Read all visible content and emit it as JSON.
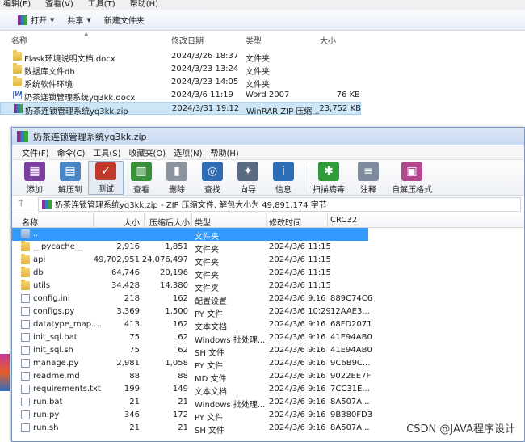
{
  "explorer": {
    "menu": [
      "编辑(E)",
      "查看(V)",
      "工具(T)",
      "帮助(H)"
    ],
    "toolbar": {
      "open": "打开",
      "share": "共享",
      "new_folder": "新建文件夹"
    },
    "columns": {
      "name": "名称",
      "date": "修改日期",
      "type": "类型",
      "size": "大小"
    },
    "rows": [
      {
        "name": "Flask环境说明文档.docx",
        "date": "2024/3/26 18:37",
        "type": "文件夹",
        "size": "",
        "icon": "folder-icon"
      },
      {
        "name": "数据库文件db",
        "date": "2024/3/23 13:24",
        "type": "文件夹",
        "size": "",
        "icon": "folder-icon"
      },
      {
        "name": "系统软件环境",
        "date": "2024/3/23 14:05",
        "type": "文件夹",
        "size": "",
        "icon": "folder-icon"
      },
      {
        "name": "奶茶连锁管理系统yq3kk.docx",
        "date": "2024/3/6 11:19",
        "type": "Word 2007",
        "size": "76 KB",
        "icon": "word-doc-icon"
      },
      {
        "name": "奶茶连锁管理系统yq3kk.zip",
        "date": "2024/3/31 19:12",
        "type": "WinRAR ZIP 压缩...",
        "size": "23,752 KB",
        "icon": "winrar-archive-icon"
      }
    ]
  },
  "winrar": {
    "title": "奶茶连锁管理系统yq3kk.zip",
    "menu": [
      "文件(F)",
      "命令(C)",
      "工具(S)",
      "收藏夹(O)",
      "选项(N)",
      "帮助(H)"
    ],
    "tools": [
      {
        "label": "添加",
        "icon": "add-icon",
        "color": "#7b3f9e"
      },
      {
        "label": "解压到",
        "icon": "extract-to-icon",
        "color": "#4b86c6"
      },
      {
        "label": "测试",
        "icon": "test-icon",
        "color": "#c0392b"
      },
      {
        "label": "查看",
        "icon": "view-icon",
        "color": "#3a8f3a"
      },
      {
        "label": "删除",
        "icon": "delete-icon",
        "color": "#8b949e"
      },
      {
        "label": "查找",
        "icon": "find-icon",
        "color": "#2f6cb3"
      },
      {
        "label": "向导",
        "icon": "wizard-icon",
        "color": "#5a6a80"
      },
      {
        "label": "信息",
        "icon": "info-icon",
        "color": "#2c6db5"
      },
      {
        "label": "扫描病毒",
        "icon": "virus-scan-icon",
        "color": "#2f9b3a"
      },
      {
        "label": "注释",
        "icon": "comment-icon",
        "color": "#7d8b9c"
      },
      {
        "label": "自解压格式",
        "icon": "sfx-icon",
        "color": "#b0478f"
      }
    ],
    "path": "奶茶连锁管理系统yq3kk.zip - ZIP 压缩文件, 解包大小为 49,891,174 字节",
    "columns": {
      "name": "名称",
      "size": "大小",
      "packed": "压缩后大小",
      "type": "类型",
      "modified": "修改时间",
      "crc": "CRC32"
    },
    "rows": [
      {
        "name": "..",
        "size": "",
        "packed": "",
        "type": "文件夹",
        "modified": "",
        "crc": "",
        "icon": "parent-folder-icon"
      },
      {
        "name": "__pycache__",
        "size": "2,916",
        "packed": "1,851",
        "type": "文件夹",
        "modified": "2024/3/6 11:15",
        "crc": "",
        "icon": "folder-icon"
      },
      {
        "name": "api",
        "size": "49,702,951",
        "packed": "24,076,497",
        "type": "文件夹",
        "modified": "2024/3/6 11:15",
        "crc": "",
        "icon": "folder-icon"
      },
      {
        "name": "db",
        "size": "64,746",
        "packed": "20,196",
        "type": "文件夹",
        "modified": "2024/3/6 11:15",
        "crc": "",
        "icon": "folder-icon"
      },
      {
        "name": "utils",
        "size": "34,428",
        "packed": "14,380",
        "type": "文件夹",
        "modified": "2024/3/6 11:15",
        "crc": "",
        "icon": "folder-icon"
      },
      {
        "name": "config.ini",
        "size": "218",
        "packed": "162",
        "type": "配置设置",
        "modified": "2024/3/6 9:16",
        "crc": "889C74C6",
        "icon": "config-file-icon"
      },
      {
        "name": "configs.py",
        "size": "3,369",
        "packed": "1,500",
        "type": "PY 文件",
        "modified": "2024/3/6 10:29",
        "crc": "12AAE3...",
        "icon": "file-icon"
      },
      {
        "name": "datatype_map....",
        "size": "413",
        "packed": "162",
        "type": "文本文档",
        "modified": "2024/3/6 9:16",
        "crc": "68FD2071",
        "icon": "file-icon"
      },
      {
        "name": "init_sql.bat",
        "size": "75",
        "packed": "62",
        "type": "Windows 批处理...",
        "modified": "2024/3/6 9:16",
        "crc": "41E94AB0",
        "icon": "batch-file-icon"
      },
      {
        "name": "init_sql.sh",
        "size": "75",
        "packed": "62",
        "type": "SH 文件",
        "modified": "2024/3/6 9:16",
        "crc": "41E94AB0",
        "icon": "file-icon"
      },
      {
        "name": "manage.py",
        "size": "2,981",
        "packed": "1,058",
        "type": "PY 文件",
        "modified": "2024/3/6 9:16",
        "crc": "9C6B9C...",
        "icon": "file-icon"
      },
      {
        "name": "readme.md",
        "size": "88",
        "packed": "88",
        "type": "MD 文件",
        "modified": "2024/3/6 9:16",
        "crc": "9022EE7F",
        "icon": "file-icon"
      },
      {
        "name": "requirements.txt",
        "size": "199",
        "packed": "149",
        "type": "文本文档",
        "modified": "2024/3/6 9:16",
        "crc": "7CC31E...",
        "icon": "file-icon"
      },
      {
        "name": "run.bat",
        "size": "21",
        "packed": "21",
        "type": "Windows 批处理...",
        "modified": "2024/3/6 9:16",
        "crc": "8A507A...",
        "icon": "batch-file-icon"
      },
      {
        "name": "run.py",
        "size": "346",
        "packed": "172",
        "type": "PY 文件",
        "modified": "2024/3/6 9:16",
        "crc": "9B380FD3",
        "icon": "file-icon"
      },
      {
        "name": "run.sh",
        "size": "21",
        "packed": "21",
        "type": "SH 文件",
        "modified": "2024/3/6 9:16",
        "crc": "8A507A...",
        "icon": "file-icon"
      }
    ]
  },
  "watermark": "CSDN @JAVA程序设计"
}
